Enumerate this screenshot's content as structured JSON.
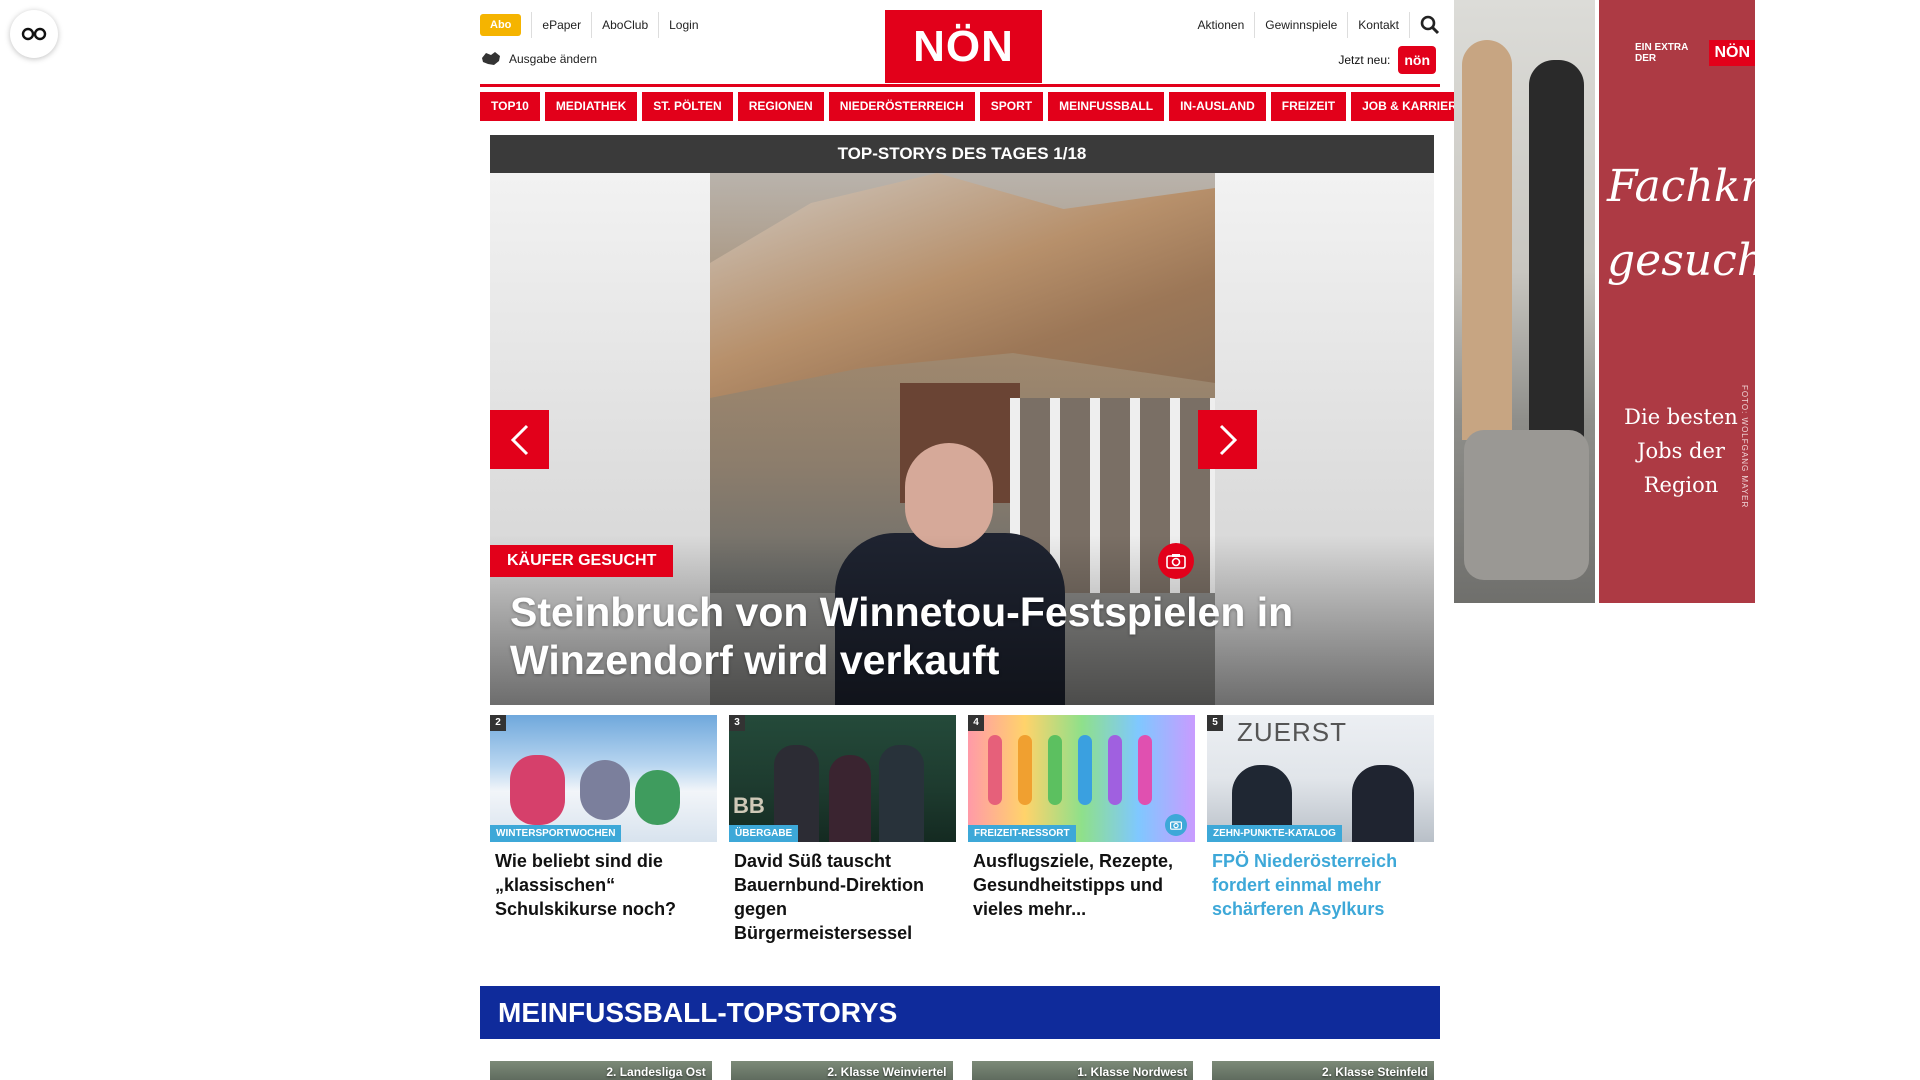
{
  "header": {
    "abo_label": "Abo",
    "util_left": [
      "ePaper",
      "AboClub",
      "Login"
    ],
    "edition_label": "Ausgabe ändern",
    "logo_text": "NÖN",
    "util_right": [
      "Aktionen",
      "Gewinnspiele",
      "Kontakt"
    ],
    "jetzt_label": "Jetzt neu:",
    "jetzt_badge": "nön"
  },
  "nav": [
    "TOP10",
    "MEDIATHEK",
    "ST. PÖLTEN",
    "REGIONEN",
    "NIEDERÖSTERREICH",
    "SPORT",
    "MEINFUSSBALL",
    "IN-AUSLAND",
    "FREIZEIT",
    "JOB & KARRIERE"
  ],
  "topstories": {
    "header": "TOP-STORYS DES TAGES 1/18",
    "hero_tag": "KÄUFER GESUCHT",
    "hero_title": "Steinbruch von Winnetou-Festspielen in Winzendorf wird verkauft",
    "cards": [
      {
        "num": "2",
        "tag": "WINTERSPORTWOCHEN",
        "title": "Wie beliebt sind die „klassischen“ Schulskikurse noch?"
      },
      {
        "num": "3",
        "tag": "ÜBERGABE",
        "title": "David Süß tauscht Bauernbund-Direktion gegen Bürgermeistersessel"
      },
      {
        "num": "4",
        "tag": "FREIZEIT-RESSORT",
        "title": "Ausflugsziele, Rezepte, Gesundheitstipps und vieles mehr..."
      },
      {
        "num": "5",
        "tag": "ZEHN-PUNKTE-KATALOG",
        "title": "FPÖ Niederösterreich fordert einmal mehr schärferen Asylkurs"
      }
    ]
  },
  "meinfussball": {
    "header": "MEINFUSSBALL-TOPSTORYS",
    "leagues": [
      "2. Landesliga Ost",
      "2. Klasse Weinviertel",
      "1. Klasse Nordwest",
      "2. Klasse Steinfeld"
    ]
  },
  "ad": {
    "small": "EIN EXTRA DER",
    "logo": "NÖN",
    "headline": "Fachkräfte gesucht",
    "sub": "Die besten Jobs der Region",
    "credit": "FOTO: WOLFGANG MAYER"
  },
  "colors": {
    "brand_red": "#e2001a",
    "abo_yellow": "#f5b400",
    "tag_blue": "#3da8d8",
    "mf_blue": "#0f2b9b",
    "ad_red": "#ad3a44"
  }
}
